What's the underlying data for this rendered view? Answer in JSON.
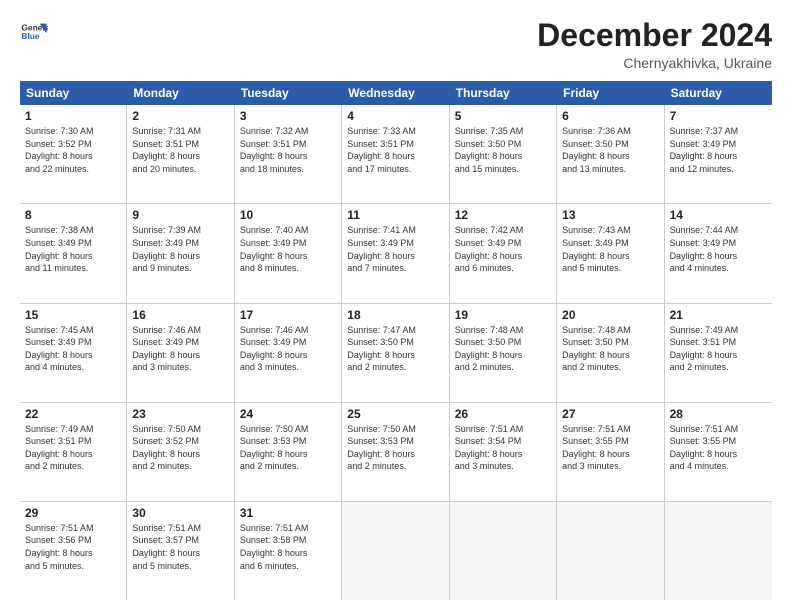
{
  "header": {
    "logo_line1": "General",
    "logo_line2": "Blue",
    "month": "December 2024",
    "location": "Chernyakhivka, Ukraine"
  },
  "weekdays": [
    "Sunday",
    "Monday",
    "Tuesday",
    "Wednesday",
    "Thursday",
    "Friday",
    "Saturday"
  ],
  "weeks": [
    [
      {
        "day": "1",
        "lines": [
          "Sunrise: 7:30 AM",
          "Sunset: 3:52 PM",
          "Daylight: 8 hours",
          "and 22 minutes."
        ]
      },
      {
        "day": "2",
        "lines": [
          "Sunrise: 7:31 AM",
          "Sunset: 3:51 PM",
          "Daylight: 8 hours",
          "and 20 minutes."
        ]
      },
      {
        "day": "3",
        "lines": [
          "Sunrise: 7:32 AM",
          "Sunset: 3:51 PM",
          "Daylight: 8 hours",
          "and 18 minutes."
        ]
      },
      {
        "day": "4",
        "lines": [
          "Sunrise: 7:33 AM",
          "Sunset: 3:51 PM",
          "Daylight: 8 hours",
          "and 17 minutes."
        ]
      },
      {
        "day": "5",
        "lines": [
          "Sunrise: 7:35 AM",
          "Sunset: 3:50 PM",
          "Daylight: 8 hours",
          "and 15 minutes."
        ]
      },
      {
        "day": "6",
        "lines": [
          "Sunrise: 7:36 AM",
          "Sunset: 3:50 PM",
          "Daylight: 8 hours",
          "and 13 minutes."
        ]
      },
      {
        "day": "7",
        "lines": [
          "Sunrise: 7:37 AM",
          "Sunset: 3:49 PM",
          "Daylight: 8 hours",
          "and 12 minutes."
        ]
      }
    ],
    [
      {
        "day": "8",
        "lines": [
          "Sunrise: 7:38 AM",
          "Sunset: 3:49 PM",
          "Daylight: 8 hours",
          "and 11 minutes."
        ]
      },
      {
        "day": "9",
        "lines": [
          "Sunrise: 7:39 AM",
          "Sunset: 3:49 PM",
          "Daylight: 8 hours",
          "and 9 minutes."
        ]
      },
      {
        "day": "10",
        "lines": [
          "Sunrise: 7:40 AM",
          "Sunset: 3:49 PM",
          "Daylight: 8 hours",
          "and 8 minutes."
        ]
      },
      {
        "day": "11",
        "lines": [
          "Sunrise: 7:41 AM",
          "Sunset: 3:49 PM",
          "Daylight: 8 hours",
          "and 7 minutes."
        ]
      },
      {
        "day": "12",
        "lines": [
          "Sunrise: 7:42 AM",
          "Sunset: 3:49 PM",
          "Daylight: 8 hours",
          "and 6 minutes."
        ]
      },
      {
        "day": "13",
        "lines": [
          "Sunrise: 7:43 AM",
          "Sunset: 3:49 PM",
          "Daylight: 8 hours",
          "and 5 minutes."
        ]
      },
      {
        "day": "14",
        "lines": [
          "Sunrise: 7:44 AM",
          "Sunset: 3:49 PM",
          "Daylight: 8 hours",
          "and 4 minutes."
        ]
      }
    ],
    [
      {
        "day": "15",
        "lines": [
          "Sunrise: 7:45 AM",
          "Sunset: 3:49 PM",
          "Daylight: 8 hours",
          "and 4 minutes."
        ]
      },
      {
        "day": "16",
        "lines": [
          "Sunrise: 7:46 AM",
          "Sunset: 3:49 PM",
          "Daylight: 8 hours",
          "and 3 minutes."
        ]
      },
      {
        "day": "17",
        "lines": [
          "Sunrise: 7:46 AM",
          "Sunset: 3:49 PM",
          "Daylight: 8 hours",
          "and 3 minutes."
        ]
      },
      {
        "day": "18",
        "lines": [
          "Sunrise: 7:47 AM",
          "Sunset: 3:50 PM",
          "Daylight: 8 hours",
          "and 2 minutes."
        ]
      },
      {
        "day": "19",
        "lines": [
          "Sunrise: 7:48 AM",
          "Sunset: 3:50 PM",
          "Daylight: 8 hours",
          "and 2 minutes."
        ]
      },
      {
        "day": "20",
        "lines": [
          "Sunrise: 7:48 AM",
          "Sunset: 3:50 PM",
          "Daylight: 8 hours",
          "and 2 minutes."
        ]
      },
      {
        "day": "21",
        "lines": [
          "Sunrise: 7:49 AM",
          "Sunset: 3:51 PM",
          "Daylight: 8 hours",
          "and 2 minutes."
        ]
      }
    ],
    [
      {
        "day": "22",
        "lines": [
          "Sunrise: 7:49 AM",
          "Sunset: 3:51 PM",
          "Daylight: 8 hours",
          "and 2 minutes."
        ]
      },
      {
        "day": "23",
        "lines": [
          "Sunrise: 7:50 AM",
          "Sunset: 3:52 PM",
          "Daylight: 8 hours",
          "and 2 minutes."
        ]
      },
      {
        "day": "24",
        "lines": [
          "Sunrise: 7:50 AM",
          "Sunset: 3:53 PM",
          "Daylight: 8 hours",
          "and 2 minutes."
        ]
      },
      {
        "day": "25",
        "lines": [
          "Sunrise: 7:50 AM",
          "Sunset: 3:53 PM",
          "Daylight: 8 hours",
          "and 2 minutes."
        ]
      },
      {
        "day": "26",
        "lines": [
          "Sunrise: 7:51 AM",
          "Sunset: 3:54 PM",
          "Daylight: 8 hours",
          "and 3 minutes."
        ]
      },
      {
        "day": "27",
        "lines": [
          "Sunrise: 7:51 AM",
          "Sunset: 3:55 PM",
          "Daylight: 8 hours",
          "and 3 minutes."
        ]
      },
      {
        "day": "28",
        "lines": [
          "Sunrise: 7:51 AM",
          "Sunset: 3:55 PM",
          "Daylight: 8 hours",
          "and 4 minutes."
        ]
      }
    ],
    [
      {
        "day": "29",
        "lines": [
          "Sunrise: 7:51 AM",
          "Sunset: 3:56 PM",
          "Daylight: 8 hours",
          "and 5 minutes."
        ]
      },
      {
        "day": "30",
        "lines": [
          "Sunrise: 7:51 AM",
          "Sunset: 3:57 PM",
          "Daylight: 8 hours",
          "and 5 minutes."
        ]
      },
      {
        "day": "31",
        "lines": [
          "Sunrise: 7:51 AM",
          "Sunset: 3:58 PM",
          "Daylight: 8 hours",
          "and 6 minutes."
        ]
      },
      null,
      null,
      null,
      null
    ]
  ]
}
